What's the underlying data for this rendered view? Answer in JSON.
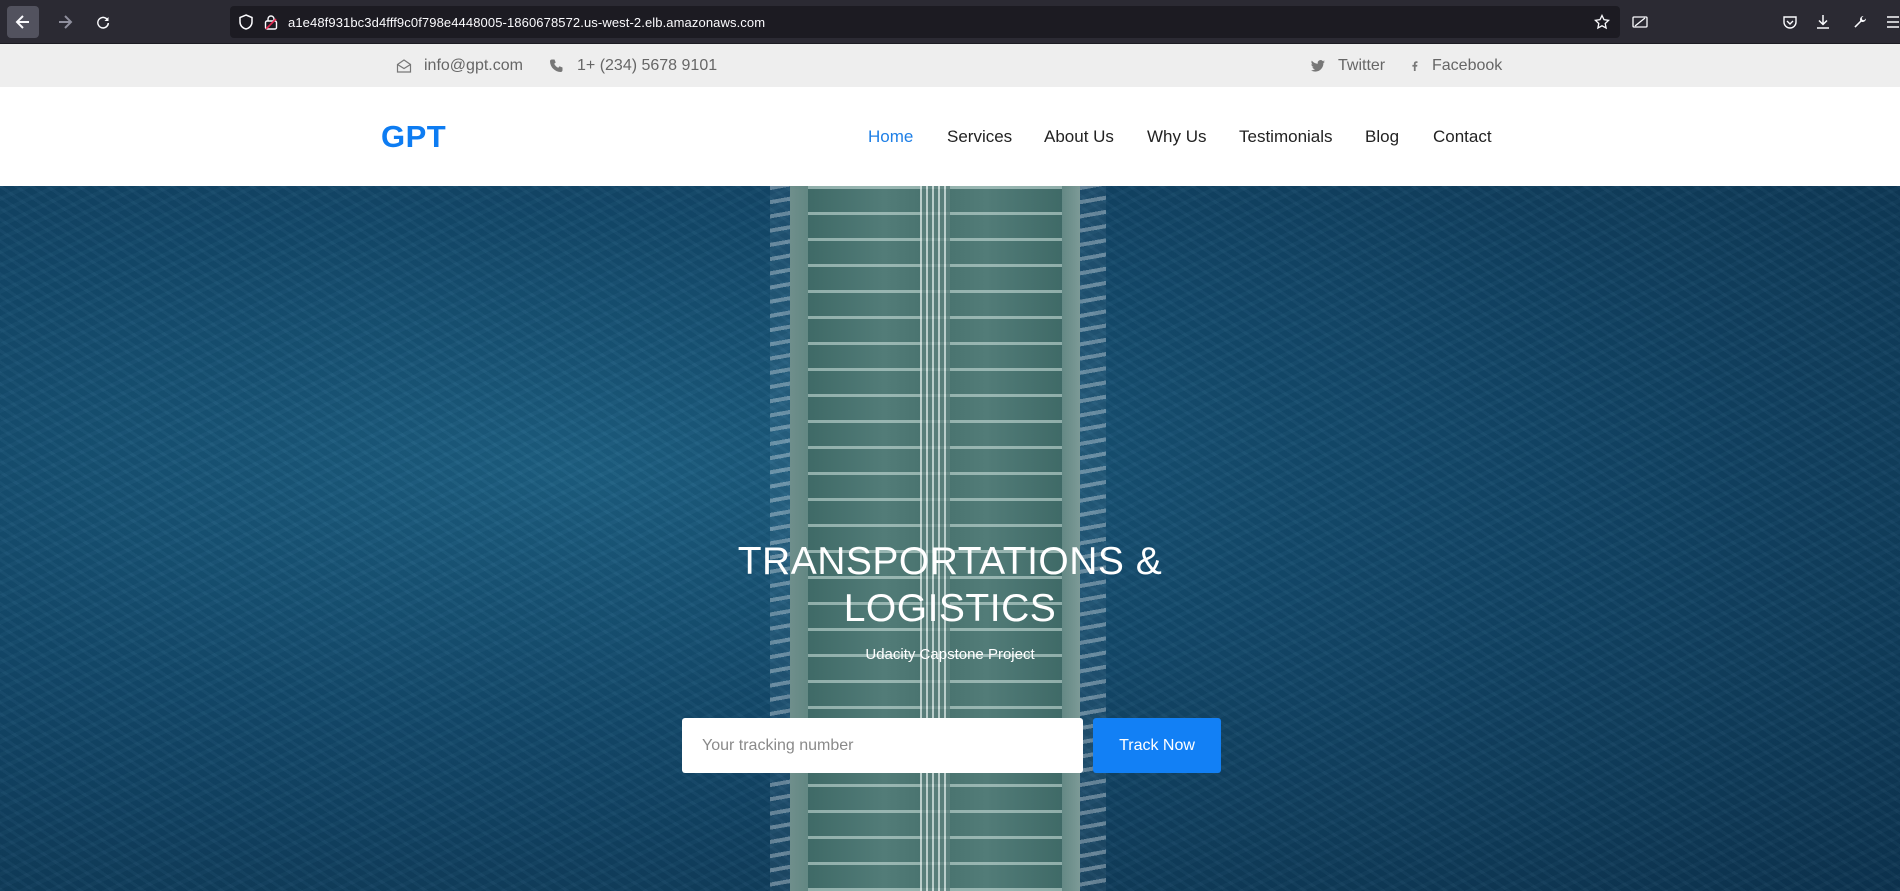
{
  "browser": {
    "url": "a1e48f931bc3d4fff9c0f798e4448005-1860678572.us-west-2.elb.amazonaws.com"
  },
  "topbar": {
    "email": "info@gpt.com",
    "phone": "1+ (234) 5678 9101",
    "twitter": "Twitter",
    "facebook": "Facebook"
  },
  "header": {
    "logo": "GPT",
    "menu": [
      "Home",
      "Services",
      "About Us",
      "Why Us",
      "Testimonials",
      "Blog",
      "Contact"
    ],
    "active": "Home"
  },
  "hero": {
    "title_line1": "TRANSPORTATIONS &",
    "title_line2": "LOGISTICS",
    "subtitle": "Udacity Capstone Project",
    "tracking_placeholder": "Your tracking number",
    "track_button": "Track Now"
  },
  "colors": {
    "brand": "#0d7cf2",
    "button": "#1280f5",
    "browser_bg": "#2b2a33"
  }
}
